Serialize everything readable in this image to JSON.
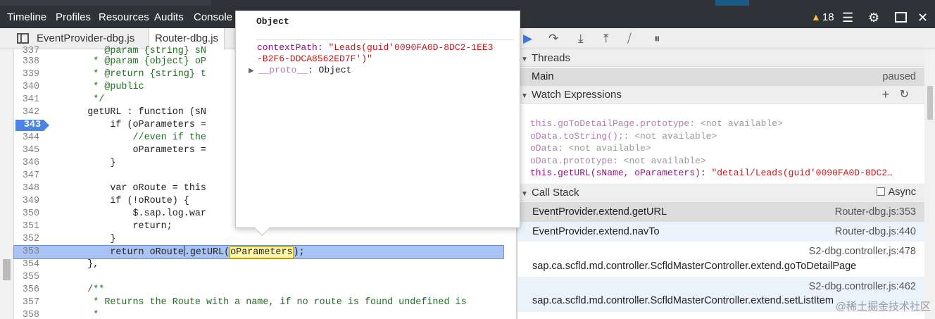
{
  "topbar": {
    "nav": [
      "Timeline",
      "Profiles",
      "Resources",
      "Audits",
      "Console"
    ],
    "warning_count": "18"
  },
  "tabs": [
    "EventProvider-dbg.js",
    "Router-dbg.js"
  ],
  "editor": {
    "lines": [
      {
        "n": "337",
        "code": "         @param {string} sN"
      },
      {
        "n": "338",
        "code": "       * @param {object} oP"
      },
      {
        "n": "339",
        "code": "       * @return {string} t"
      },
      {
        "n": "340",
        "code": "       * @public"
      },
      {
        "n": "341",
        "code": "       */"
      },
      {
        "n": "342",
        "code": "      getURL : function (sN"
      },
      {
        "n": "343",
        "code": "          if (oParameters ="
      },
      {
        "n": "344",
        "code": "              //even if the"
      },
      {
        "n": "345",
        "code": "              oParameters ="
      },
      {
        "n": "346",
        "code": "          }"
      },
      {
        "n": "347",
        "code": ""
      },
      {
        "n": "348",
        "code": "          var oRoute = this"
      },
      {
        "n": "349",
        "code": "          if (!oRoute) {"
      },
      {
        "n": "350",
        "code": "              $.sap.log.war"
      },
      {
        "n": "351",
        "code": "              return;"
      },
      {
        "n": "352",
        "code": "          }"
      },
      {
        "n": "353",
        "code": ""
      },
      {
        "n": "354",
        "code": "      },"
      },
      {
        "n": "355",
        "code": ""
      },
      {
        "n": "356",
        "code": "      /**"
      },
      {
        "n": "357",
        "code": "       * Returns the Route with a name, if no route is found undefined is"
      },
      {
        "n": "358",
        "code": "       *"
      }
    ],
    "line353": {
      "pre": "          return oRoute",
      "mid": ".getURL(",
      "param": "oParameters",
      "post": ");"
    }
  },
  "popover": {
    "title": "Object",
    "prop_key": "contextPath",
    "prop_value": "\"Leads(guid'0090FA0D-8DC2-1EE3-B2F6-DDCA8562ED7F')\"",
    "proto_key": "__proto__",
    "proto_value": "Object"
  },
  "threads": {
    "header": "Threads",
    "main": "Main",
    "status": "paused"
  },
  "watch": {
    "header": "Watch Expressions",
    "items": [
      {
        "name": "this.goToDetailPage.prototype",
        "value": "<not available>"
      },
      {
        "name": "oData.toString();",
        "value": "<not available>"
      },
      {
        "name": "oData",
        "value": "<not available>"
      },
      {
        "name": "oData.prototype",
        "value": "<not available>"
      },
      {
        "name": "this.getURL(sName, oParameters)",
        "value": "\"detail/Leads(guid'0090FA0D-8DC2…"
      }
    ]
  },
  "callstack": {
    "header": "Call Stack",
    "async_label": "Async",
    "frames": [
      {
        "fn": "EventProvider.extend.getURL",
        "loc": "Router-dbg.js:353"
      },
      {
        "fn": "EventProvider.extend.navTo",
        "loc": "Router-dbg.js:440"
      },
      {
        "fn": "sap.ca.scfld.md.controller.ScfldMasterController.extend.goToDetailPage",
        "loc": "S2-dbg.controller.js:478"
      },
      {
        "fn": "sap.ca.scfld.md.controller.ScfldMasterController.extend.setListItem",
        "loc": "S2-dbg.controller.js:462"
      }
    ]
  },
  "watermark": "@稀土掘金技术社区"
}
